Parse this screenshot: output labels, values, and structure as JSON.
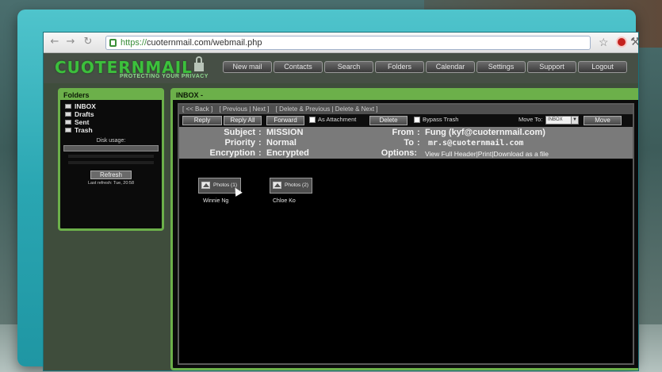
{
  "browser": {
    "url_https": "https://",
    "url_rest": "cuoternmail.com/webmail.php",
    "back_icon": "back-arrow-icon",
    "forward_icon": "forward-arrow-icon",
    "reload_icon": "reload-icon",
    "star_icon": "star-icon",
    "wrench_icon": "wrench-icon"
  },
  "app": {
    "logo_text": "CUOTERNMAIL",
    "tagline": "PROTECTING YOUR PRIVACY",
    "accent_color": "#6cb04a",
    "nav": [
      "New mail",
      "Contacts",
      "Search",
      "Folders",
      "Calendar",
      "Settings",
      "Support",
      "Logout"
    ]
  },
  "sidebar": {
    "title": "Folders",
    "folders": [
      "INBOX",
      "Drafts",
      "Sent",
      "Trash"
    ],
    "disk_usage_label": "Disk usage:",
    "refresh_label": "Refresh",
    "last_refresh": "Last refresh: Tue, 20:58"
  },
  "main": {
    "title": "INBOX -",
    "links": {
      "back": "[ << Back ]",
      "previous": "[ Previous | Next ]",
      "delete_prev_next": "[ Delete & Previous | Delete & Next ]"
    },
    "toolbar": {
      "reply": "Reply",
      "reply_all": "Reply All",
      "forward": "Forward",
      "as_attachment": "As Attachment",
      "delete": "Delete",
      "bypass_trash": "Bypass Trash",
      "move_to_label": "Move To:",
      "move_to_value": "INBOX",
      "move": "Move"
    },
    "message": {
      "subject_label": "Subject",
      "subject": "MISSION",
      "priority_label": "Priority",
      "priority": "Normal",
      "encryption_label": "Encryption",
      "encryption": "Encrypted",
      "from_label": "From",
      "from": "Fung (kyf@cuoternmail.com)",
      "to_label": "To",
      "to": "mr.s@cuoternmail.com",
      "options_label": "Options:",
      "options": "View Full Header|Print|Download as a file"
    },
    "attachments": [
      {
        "label": "Photos (1)",
        "name": "Winnie Ng"
      },
      {
        "label": "Photos (2)",
        "name": "Chloe Ko"
      }
    ]
  }
}
